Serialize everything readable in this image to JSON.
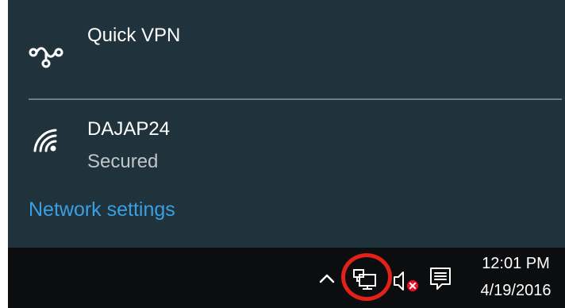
{
  "flyout": {
    "vpn": {
      "name": "Quick VPN",
      "icon": "vpn-icon"
    },
    "wifi": {
      "name": "DAJAP24",
      "status": "Secured",
      "icon": "wifi-icon"
    },
    "network_settings_label": "Network settings"
  },
  "taskbar": {
    "icons": [
      "chevron-up-icon",
      "network-icon",
      "volume-muted-icon",
      "action-center-icon"
    ],
    "time": "12:01 PM",
    "date": "4/19/2016"
  },
  "colors": {
    "flyout_bg": "#20323c",
    "taskbar_bg": "#0c0d0f",
    "link": "#3aa0e0",
    "highlight": "#e32119",
    "mute_badge": "#e81123"
  }
}
